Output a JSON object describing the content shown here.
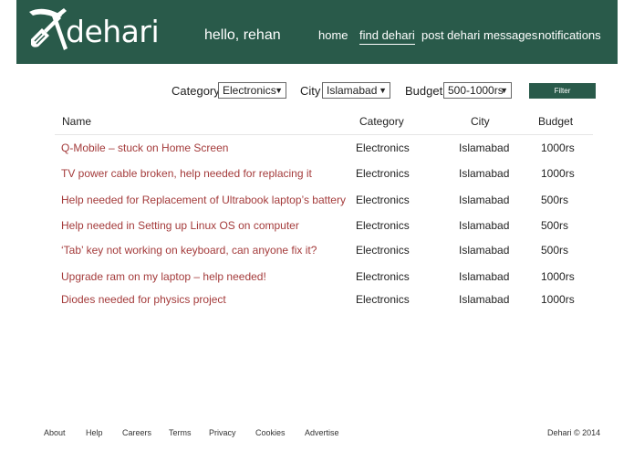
{
  "brand": {
    "name": "dehari",
    "header_color": "#295a4a",
    "link_color": "#a43b3b"
  },
  "greeting": "hello, rehan",
  "nav": [
    {
      "label": "home",
      "active": false
    },
    {
      "label": "find dehari",
      "active": true
    },
    {
      "label": "post dehari",
      "active": false
    },
    {
      "label": "messages",
      "active": false
    },
    {
      "label": "notifications",
      "active": false
    }
  ],
  "filters": {
    "category": {
      "label": "Category",
      "value": "Electronics"
    },
    "city": {
      "label": "City",
      "value": "Islamabad"
    },
    "budget": {
      "label": "Budget",
      "value": "500-1000rs"
    },
    "button_label": "Filter"
  },
  "table": {
    "headers": {
      "name": "Name",
      "category": "Category",
      "city": "City",
      "budget": "Budget"
    },
    "rows": [
      {
        "name": "Q-Mobile – stuck on Home Screen",
        "category": "Electronics",
        "city": "Islamabad",
        "budget": "1000rs"
      },
      {
        "name": "TV power cable broken, help needed for replacing it",
        "category": "Electronics",
        "city": "Islamabad",
        "budget": "1000rs"
      },
      {
        "name": "Help needed for Replacement of Ultrabook laptop’s battery",
        "category": "Electronics",
        "city": "Islamabad",
        "budget": "500rs"
      },
      {
        "name": "Help needed in Setting up Linux OS on computer",
        "category": "Electronics",
        "city": "Islamabad",
        "budget": "500rs"
      },
      {
        "name": "‘Tab’ key not working on keyboard, can anyone fix it?",
        "category": "Electronics",
        "city": "Islamabad",
        "budget": "500rs"
      },
      {
        "name": "Upgrade ram on my laptop – help needed!",
        "category": "Electronics",
        "city": "Islamabad",
        "budget": "1000rs"
      },
      {
        "name": "Diodes needed for physics project",
        "category": "Electronics",
        "city": "Islamabad",
        "budget": "1000rs"
      }
    ]
  },
  "footer": {
    "links": [
      "About",
      "Help",
      "Careers",
      "Terms",
      "Privacy",
      "Cookies",
      "Advertise"
    ],
    "copyright": "Dehari © 2014"
  },
  "icons": {
    "logo": "pickaxe-shovel-icon",
    "dropdown": "triangle-down-icon"
  }
}
